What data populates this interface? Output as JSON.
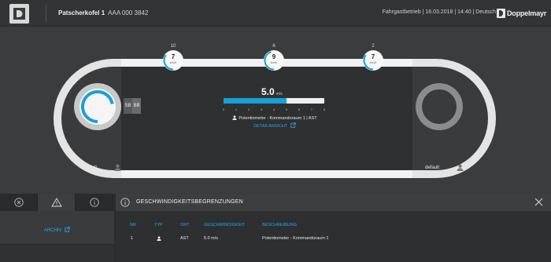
{
  "header": {
    "station_name": "Patscherkofel 1",
    "station_id": "AAA 000 3842",
    "status": "Fahrgastbetrieb | 16.03.2018 | 14:40 | Deutsch",
    "brand": "Doppelmayr"
  },
  "sensors": [
    {
      "label": "10",
      "value": "7",
      "unit": "km/h",
      "level": 0.35
    },
    {
      "label": "6",
      "value": "9",
      "unit": "km/h",
      "level": 0.45
    },
    {
      "label": "2",
      "value": "7",
      "unit": "km/h",
      "level": 0.35
    }
  ],
  "left_station": {
    "sb": "SB",
    "bb": "BB",
    "progress": 0.72,
    "user": "default"
  },
  "right_station": {
    "user": "default"
  },
  "speed": {
    "value": "5.0",
    "unit": "m/s",
    "gauge_fraction": 0.625,
    "ticks": [
      "0",
      "1",
      "2",
      "3",
      "4",
      "5",
      "6",
      "7",
      "8"
    ],
    "source": "Potentiometer - Kommandoraum 1 | AST",
    "detail_link": "DETAILANSICHT"
  },
  "left_panel": {
    "tabs": [
      "close-circle-icon",
      "warning-icon",
      "info-icon"
    ],
    "archive_link": "ARCHIV"
  },
  "limits_panel": {
    "title": "GESCHWINDIGKEITSBEGRENZUNGEN",
    "columns": [
      "NR",
      "TYP",
      "ORT",
      "GESCHWINDIGKEIT",
      "BESCHREIBUNG"
    ],
    "rows": [
      {
        "nr": "1",
        "typ": "user-icon",
        "ort": "AST",
        "speed": "5.0 m/s",
        "desc": "Potentiometer - Kommandoraum 1"
      }
    ]
  },
  "colors": {
    "accent": "#1a9fd6",
    "link": "#2ba8e0",
    "background": "#3b3c3e"
  }
}
